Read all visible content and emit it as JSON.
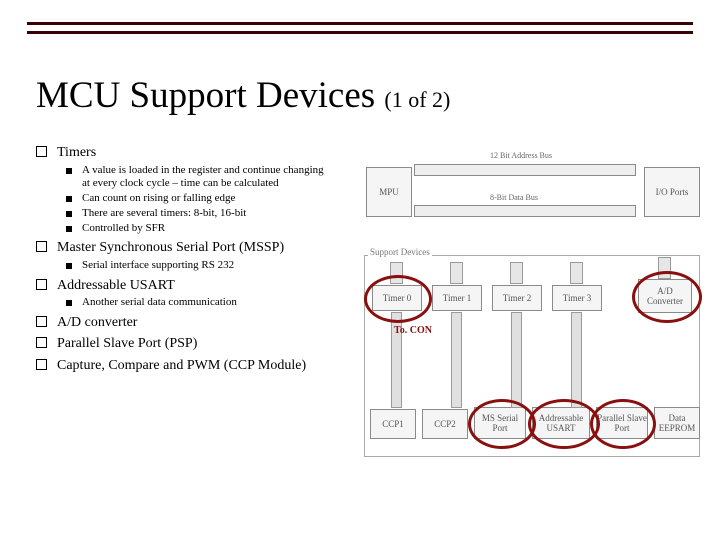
{
  "title_main": "MCU Support Devices ",
  "title_sub": "(1 of 2)",
  "bullets": {
    "timers": "Timers",
    "timers_sub": [
      "A value is loaded in the register and continue changing at every clock cycle – time can be calculated",
      "Can count on rising or falling edge",
      "There are several timers: 8-bit, 16-bit",
      "Controlled by SFR"
    ],
    "mssp": "Master Synchronous Serial Port (MSSP)",
    "mssp_sub": [
      "Serial interface supporting RS 232"
    ],
    "usart": "Addressable USART",
    "usart_sub": [
      "Another serial data communication"
    ],
    "adc": "A/D converter",
    "psp": "Parallel Slave Port (PSP)",
    "ccp": "Capture, Compare and PWM (CCP Module)"
  },
  "diagram": {
    "mpu": "MPU",
    "io": "I/O Ports",
    "addr": "12 Bit\nAddress Bus",
    "data": "8-Bit Data Bus",
    "support": "Support Devices",
    "row1": [
      "Timer 0",
      "Timer 1",
      "Timer 2",
      "Timer 3",
      "A/D\nConverter"
    ],
    "row2": [
      "CCP1",
      "CCP2",
      "MS\nSerial Port",
      "Addressable\nUSART",
      "Parallel\nSlave Port",
      "Data\nEEPROM"
    ],
    "tocon": "To. CON"
  }
}
